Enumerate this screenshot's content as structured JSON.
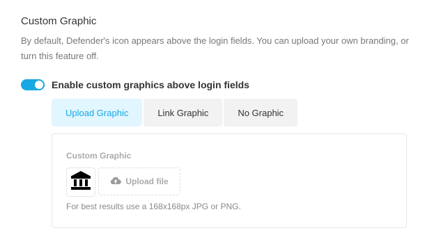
{
  "section": {
    "title": "Custom Graphic",
    "description": "By default, Defender's icon appears above the login fields. You can upload your own branding, or turn this feature off."
  },
  "toggle": {
    "label": "Enable custom graphics above login fields",
    "enabled": true,
    "accent_color": "#17a8e3"
  },
  "tabs": [
    {
      "label": "Upload Graphic",
      "active": true
    },
    {
      "label": "Link Graphic",
      "active": false
    },
    {
      "label": "No Graphic",
      "active": false
    }
  ],
  "panel": {
    "label": "Custom Graphic",
    "preview_icon": "bank-building-icon",
    "upload_label": "Upload file",
    "upload_icon": "cloud-upload-icon",
    "hint": "For best results use a 168x168px JPG or PNG."
  }
}
